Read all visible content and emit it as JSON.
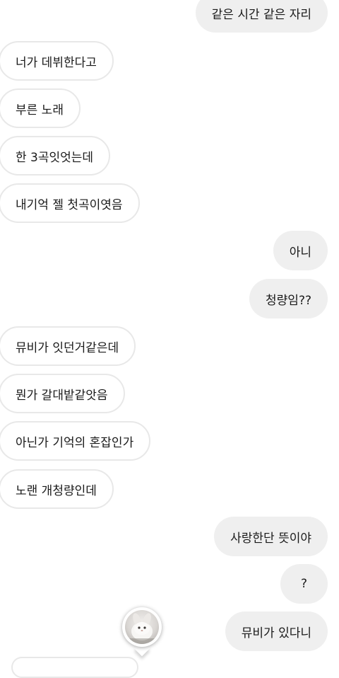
{
  "messages": [
    {
      "side": "sent",
      "text": "같은 시간 같은 자리"
    },
    {
      "side": "received",
      "text": "너가 데뷔한다고"
    },
    {
      "side": "received",
      "text": "부른 노래"
    },
    {
      "side": "received",
      "text": "한 3곡잇엇는데"
    },
    {
      "side": "received",
      "text": "내기억 젤 첫곡이엿음"
    },
    {
      "side": "sent",
      "text": "아니"
    },
    {
      "side": "sent",
      "text": "청량임??"
    },
    {
      "side": "received",
      "text": "뮤비가 잇던거같은데"
    },
    {
      "side": "received",
      "text": "뭔가 갈대밭같앗음"
    },
    {
      "side": "received",
      "text": "아닌가 기억의 혼잡인가"
    },
    {
      "side": "received",
      "text": "노랜 개청량인데"
    },
    {
      "side": "sent",
      "text": "사랑한단 뜻이야"
    },
    {
      "side": "sent",
      "text": "?"
    },
    {
      "side": "sent",
      "text": "뮤비가 있다니"
    }
  ],
  "avatar": {
    "icon": "profile-photo-avatar"
  },
  "colors": {
    "sent_bubble": "#efefef",
    "received_border": "#e8e8e8",
    "text": "#1a1a1a",
    "background": "#ffffff"
  }
}
